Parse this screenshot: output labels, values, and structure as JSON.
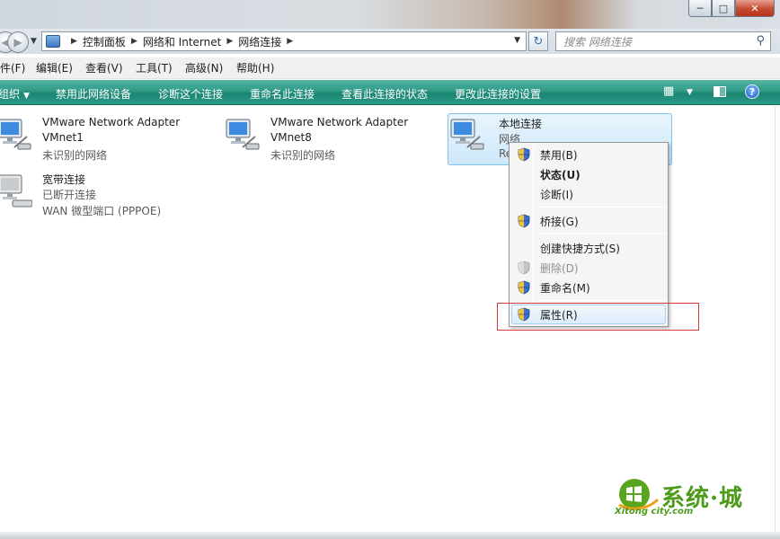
{
  "address": {
    "crumbs": [
      "控制面板",
      "网络和 Internet",
      "网络连接"
    ],
    "search_placeholder": "搜索 网络连接"
  },
  "menubar": {
    "items": [
      "件(F)",
      "编辑(E)",
      "查看(V)",
      "工具(T)",
      "高级(N)",
      "帮助(H)"
    ]
  },
  "commandbar": {
    "organize": "组织",
    "items": [
      "禁用此网络设备",
      "诊断这个连接",
      "重命名此连接",
      "查看此连接的状态",
      "更改此连接的设置"
    ],
    "help": "?"
  },
  "connections": [
    {
      "name": "VMware Network Adapter",
      "line2": "VMnet1",
      "line3": "未识别的网络"
    },
    {
      "name": "VMware Network Adapter",
      "line2": "VMnet8",
      "line3": "未识别的网络"
    },
    {
      "name": "本地连接",
      "line2": "网络",
      "line3": "Re"
    },
    {
      "name": "宽带连接",
      "line2": "已断开连接",
      "line3": "WAN 微型端口 (PPPOE)"
    }
  ],
  "context_menu": {
    "items": [
      {
        "label": "禁用(B)",
        "shield": true,
        "bold": false,
        "disabled": false
      },
      {
        "label": "状态(U)",
        "shield": false,
        "bold": true,
        "disabled": false
      },
      {
        "label": "诊断(I)",
        "shield": false,
        "bold": false,
        "disabled": false
      },
      {
        "label": "桥接(G)",
        "shield": true,
        "bold": false,
        "disabled": false
      },
      {
        "label": "创建快捷方式(S)",
        "shield": false,
        "bold": false,
        "disabled": false
      },
      {
        "label": "删除(D)",
        "shield": true,
        "bold": false,
        "disabled": true
      },
      {
        "label": "重命名(M)",
        "shield": true,
        "bold": false,
        "disabled": false
      },
      {
        "label": "属性(R)",
        "shield": true,
        "bold": false,
        "disabled": false
      }
    ],
    "highlighted_index": 7
  },
  "watermark": {
    "main": "系统·城",
    "sub": "Xitong city.com"
  },
  "colors": {
    "command_bar": "#2f9a86",
    "annotation_box": "#d53a3a",
    "selection": "#cde8fa",
    "watermark": "#4e9a1a"
  }
}
